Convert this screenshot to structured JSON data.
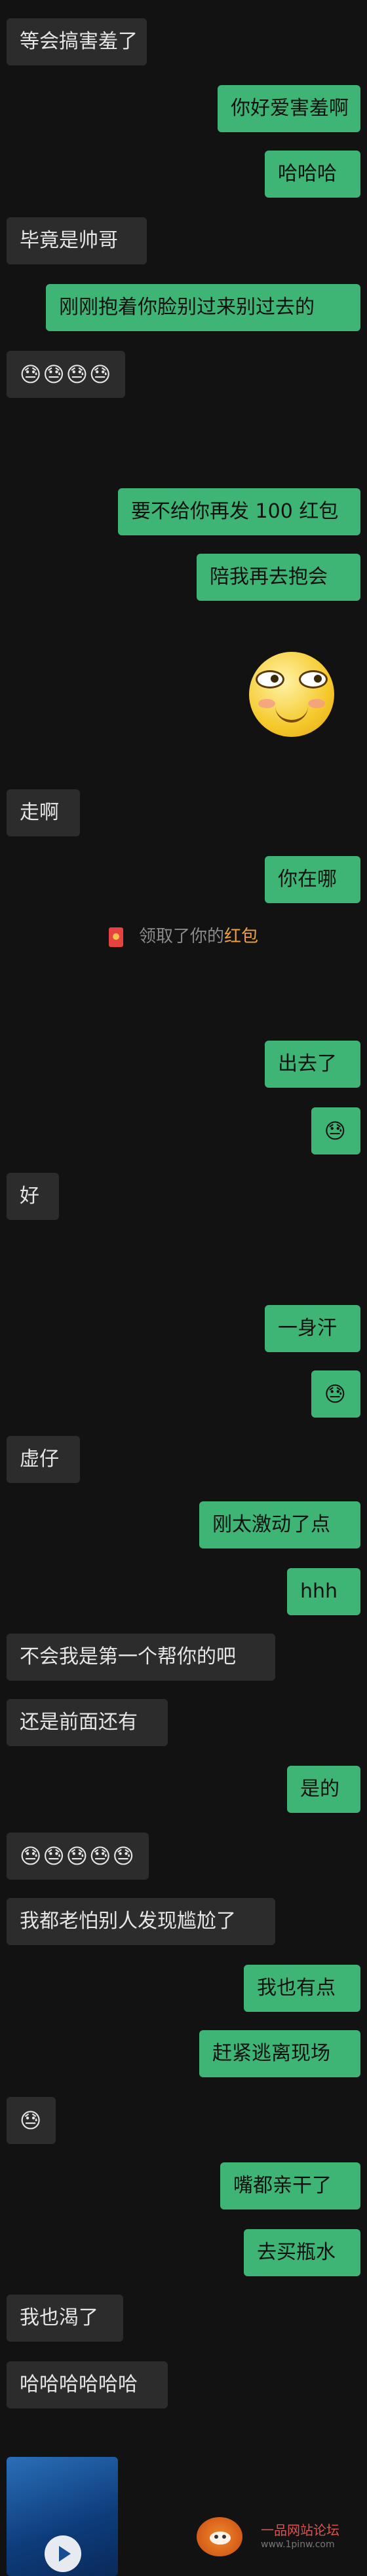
{
  "messages": [
    {
      "side": "left",
      "type": "text",
      "text": "等会搞害羞了"
    },
    {
      "side": "right",
      "type": "text",
      "text": "你好爱害羞啊"
    },
    {
      "side": "right",
      "type": "text",
      "text": "哈哈哈"
    },
    {
      "side": "left",
      "type": "text",
      "text": "毕竟是帅哥"
    },
    {
      "side": "right",
      "type": "text",
      "text": "刚刚抱着你脸别过来别过去的"
    },
    {
      "side": "left",
      "type": "emoji",
      "count": 4,
      "emoji": "😓"
    },
    {
      "side": "right",
      "type": "text",
      "text": "要不给你再发 100 红包"
    },
    {
      "side": "right",
      "type": "text",
      "text": "陪我再去抱会"
    },
    {
      "side": "right",
      "type": "sticker",
      "sticker": "blushing-smile-sticker"
    },
    {
      "side": "left",
      "type": "text",
      "text": "走啊"
    },
    {
      "side": "right",
      "type": "text",
      "text": "你在哪"
    },
    {
      "side": "system",
      "type": "system",
      "text_pre": "领取了你的",
      "text_hl": "红包"
    },
    {
      "side": "right",
      "type": "text",
      "text": "出去了"
    },
    {
      "side": "right",
      "type": "emoji",
      "count": 1,
      "emoji": "😓"
    },
    {
      "side": "left",
      "type": "text",
      "text": "好"
    },
    {
      "side": "right",
      "type": "text",
      "text": "一身汗"
    },
    {
      "side": "right",
      "type": "emoji",
      "count": 1,
      "emoji": "😓"
    },
    {
      "side": "left",
      "type": "text",
      "text": "虚仔"
    },
    {
      "side": "right",
      "type": "text",
      "text": "刚太激动了点"
    },
    {
      "side": "right",
      "type": "text",
      "text": "hhh"
    },
    {
      "side": "left",
      "type": "text",
      "text": "不会我是第一个帮你的吧"
    },
    {
      "side": "left",
      "type": "text",
      "text": "还是前面还有"
    },
    {
      "side": "right",
      "type": "text",
      "text": "是的"
    },
    {
      "side": "left",
      "type": "emoji",
      "count": 5,
      "emoji": "😓"
    },
    {
      "side": "left",
      "type": "text",
      "text": "我都老怕别人发现尴尬了"
    },
    {
      "side": "right",
      "type": "text",
      "text": "我也有点"
    },
    {
      "side": "right",
      "type": "text",
      "text": "赶紧逃离现场"
    },
    {
      "side": "left",
      "type": "emoji",
      "count": 1,
      "emoji": "😓"
    },
    {
      "side": "right",
      "type": "text",
      "text": "嘴都亲干了"
    },
    {
      "side": "right",
      "type": "text",
      "text": "去买瓶水"
    },
    {
      "side": "left",
      "type": "text",
      "text": "我也渴了"
    },
    {
      "side": "left",
      "type": "text",
      "text": "哈哈哈哈哈哈"
    },
    {
      "side": "left",
      "type": "video",
      "video": "video-thumbnail"
    }
  ],
  "watermark": {
    "title": "一品网站论坛",
    "sub": "www.1pinw.com"
  },
  "colors": {
    "background": "#121212",
    "incoming": "#2c2c2c",
    "outgoing": "#3eb575",
    "highlight": "#f0a13c"
  }
}
